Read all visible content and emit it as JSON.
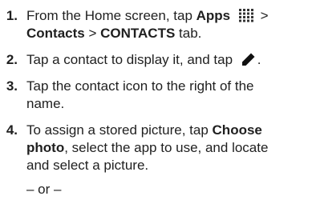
{
  "steps": [
    {
      "number": "1.",
      "parts": {
        "a": "From the Home screen, tap ",
        "apps": "Apps",
        "sep1": " > ",
        "contacts": "Contacts",
        "sep2": " > ",
        "contacts_tab": "CONTACTS",
        "end": " tab."
      },
      "icon": "apps-grid-icon"
    },
    {
      "number": "2.",
      "parts": {
        "a": "Tap a contact to display it, and tap ",
        "end": "."
      },
      "icon": "pencil-edit-icon"
    },
    {
      "number": "3.",
      "lines": [
        "Tap the contact icon to the right of the",
        "name."
      ]
    },
    {
      "number": "4.",
      "parts": {
        "a": "To assign a stored picture, tap ",
        "choose": "Choose",
        "photo": "photo",
        "b": ", select the app to use, and locate",
        "c": "and select a picture."
      }
    }
  ],
  "or_separator": "– or –"
}
